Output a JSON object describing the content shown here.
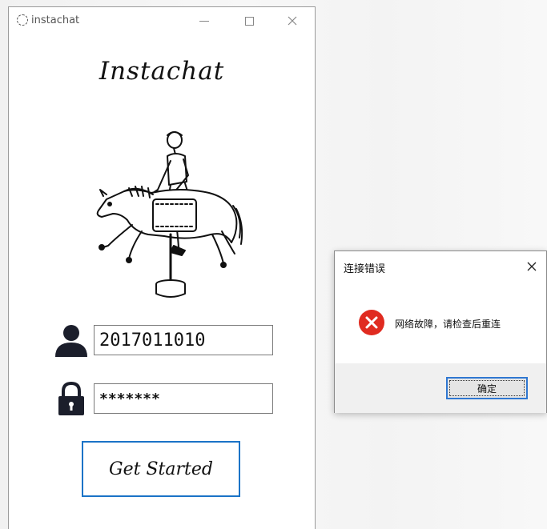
{
  "app_window": {
    "title": "instachat",
    "heading": "Instachat",
    "username_value": "2017011010",
    "password_value": "*******",
    "start_button_label": "Get Started"
  },
  "error_dialog": {
    "title": "连接错误",
    "message": "网络故障，请检查后重连",
    "ok_button_label": "确定"
  },
  "colors": {
    "accent_blue": "#1a73c7",
    "error_red": "#e02b20"
  },
  "icons": [
    "app-logo-icon",
    "minimize-icon",
    "maximize-icon",
    "close-icon",
    "user-icon",
    "lock-icon",
    "error-icon",
    "horse-rider-illustration"
  ]
}
